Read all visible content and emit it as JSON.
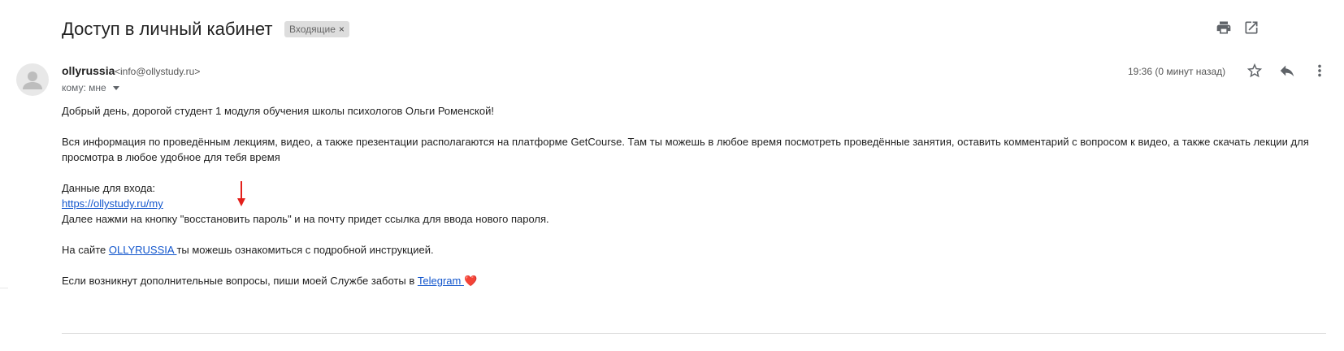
{
  "header": {
    "subject": "Доступ в личный кабинет",
    "label_chip": "Входящие",
    "label_remove": "×",
    "print_icon": "print-icon",
    "new_window_icon": "open-in-new-window-icon"
  },
  "message": {
    "sender_name": "ollyrussia",
    "sender_email": "<info@ollystudy.ru>",
    "to_line": "кому: мне",
    "timestamp": "19:36 (0 минут назад)",
    "actions": [
      "star-icon",
      "reply-icon",
      "more-vert-icon"
    ]
  },
  "body": {
    "greeting": "Добрый день, дорогой студент 1 модуля обучения школы психологов Ольги Роменской!",
    "info": "Вся информация по проведённым лекциям, видео, а также презентации располагаются на платформе GetCourse. Там ты можешь в любое время посмотреть проведённые занятия, оставить комментарий с вопросом к видео, а также скачать лекции для просмотра в любое удобное для тебя время",
    "login_label": "Данные для входа:",
    "login_link": "https://ollystudy.ru/my",
    "restore_hint": "Далее нажми на кнопку \"восстановить пароль\" и на почту придет ссылка для ввода нового пароля.",
    "site_prefix": "На сайте ",
    "site_link": "OLLYRUSSIA ",
    "site_suffix": "ты можешь ознакомиться с подробной инструкцией.",
    "support_prefix": "Если возникнут дополнительные вопросы, пиши моей Службе заботы в ",
    "support_link": "Telegram ",
    "heart": "❤️"
  },
  "colors": {
    "link": "#1155cc",
    "annotation_arrow": "#e3201b",
    "chip_bg": "#dddddd",
    "heart": "#e0393e"
  }
}
